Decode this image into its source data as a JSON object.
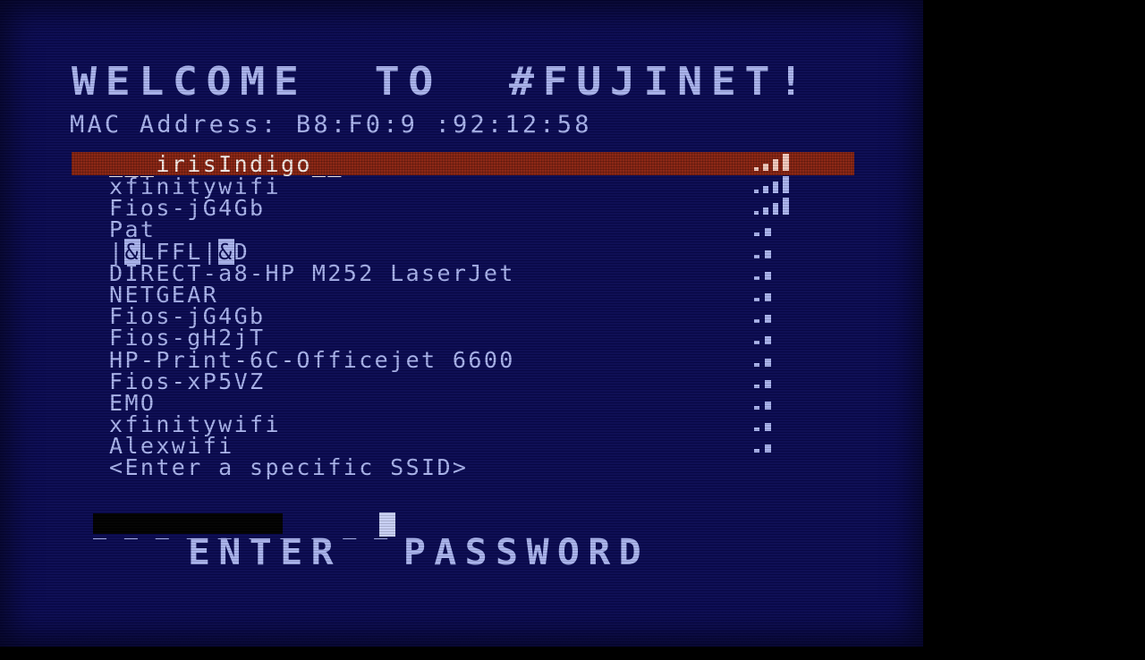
{
  "screen": {
    "title": "WELCOME  TO  #FUJINET!",
    "mac_label_line": "MAC Address: B8:F0:9 :92:12:58",
    "background_color": "#0a0a52",
    "text_color": "#aab4ee",
    "highlight_color": "#8a2412",
    "highlight_text_color": "#f2e7e2",
    "letterbox_color": "#000000"
  },
  "network_list": {
    "rows": [
      {
        "ssid": "___irisIndigo__",
        "signal": "strong",
        "selected": true,
        "garbled": false
      },
      {
        "ssid": "xfinitywifi",
        "signal": "strong",
        "selected": false,
        "garbled": false
      },
      {
        "ssid": "Fios-jG4Gb",
        "signal": "strong",
        "selected": false,
        "garbled": false
      },
      {
        "ssid": "Pat",
        "signal": "weak",
        "selected": false,
        "garbled": false
      },
      {
        "ssid": "|&LFFL|&D",
        "signal": "weak",
        "selected": false,
        "garbled": true
      },
      {
        "ssid": "DIRECT-a8-HP M252 LaserJet",
        "signal": "weak",
        "selected": false,
        "garbled": false
      },
      {
        "ssid": "NETGEAR",
        "signal": "weak",
        "selected": false,
        "garbled": false
      },
      {
        "ssid": "Fios-jG4Gb",
        "signal": "weak",
        "selected": false,
        "garbled": false
      },
      {
        "ssid": "Fios-gH2jT",
        "signal": "weak",
        "selected": false,
        "garbled": false
      },
      {
        "ssid": "HP-Print-6C-Officejet 6600",
        "signal": "weak",
        "selected": false,
        "garbled": false
      },
      {
        "ssid": "Fios-xP5VZ",
        "signal": "weak",
        "selected": false,
        "garbled": false
      },
      {
        "ssid": "EMO",
        "signal": "weak",
        "selected": false,
        "garbled": false
      },
      {
        "ssid": "xfinitywifi",
        "signal": "weak",
        "selected": false,
        "garbled": false
      },
      {
        "ssid": "Alexwifi",
        "signal": "weak",
        "selected": false,
        "garbled": false
      },
      {
        "ssid": "<Enter a specific SSID>",
        "signal": "none",
        "selected": false,
        "garbled": false
      }
    ]
  },
  "password_entry": {
    "field_value": "",
    "field_mask": "_ _ _ _ _ _ _ _ _ _",
    "redacted": true,
    "cursor_visible": true,
    "prompt": "ENTER  PASSWORD"
  }
}
